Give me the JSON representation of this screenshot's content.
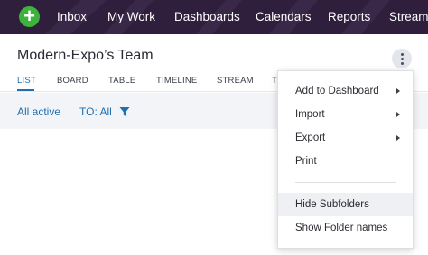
{
  "nav": {
    "add_icon": "plus-icon",
    "items": [
      "Inbox",
      "My Work",
      "Dashboards",
      "Calendars",
      "Reports",
      "Stream"
    ]
  },
  "header": {
    "title": "Modern-Expo’s Team"
  },
  "tabs": [
    "LIST",
    "BOARD",
    "TABLE",
    "TIMELINE",
    "STREAM",
    "T"
  ],
  "filters": {
    "status": "All active",
    "to": "TO: All",
    "filter_icon": "funnel-icon"
  },
  "menu": {
    "items": [
      {
        "label": "Add to Dashboard",
        "submenu": true
      },
      {
        "label": "Import",
        "submenu": true
      },
      {
        "label": "Export",
        "submenu": true
      },
      {
        "label": "Print",
        "submenu": false
      },
      {
        "label": "Hide Subfolders",
        "submenu": false
      },
      {
        "label": "Show Folder names",
        "submenu": false
      }
    ]
  },
  "colors": {
    "nav_bg": "#2f1f3c",
    "accent": "#1f6fb2",
    "add_button": "#3cb33a"
  }
}
